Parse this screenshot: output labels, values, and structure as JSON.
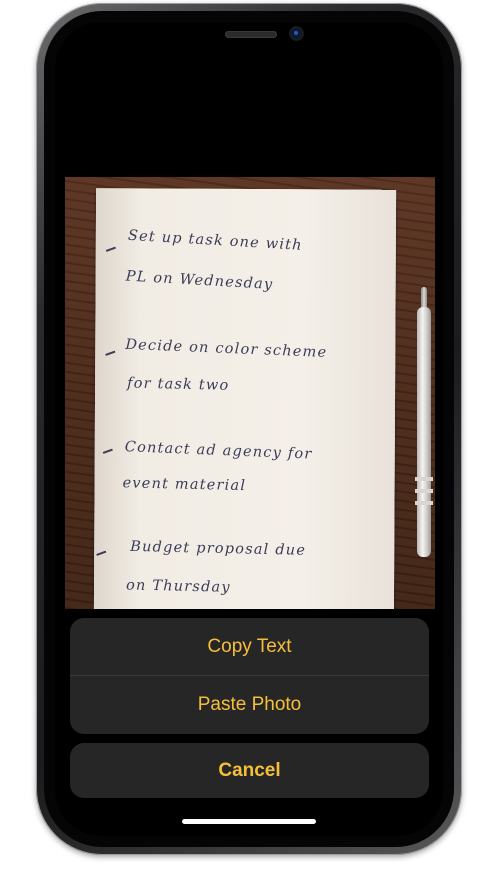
{
  "action_sheet": {
    "copy_text_label": "Copy Text",
    "paste_photo_label": "Paste Photo",
    "cancel_label": "Cancel"
  },
  "photo": {
    "notes": [
      "Set up task one with",
      "PL on Wednesday",
      "Decide on color scheme",
      "for task two",
      "Contact ad agency for",
      "event material",
      "Budget proposal due",
      "on Thursday"
    ]
  },
  "colors": {
    "accent": "#f6bf3a",
    "sheet_background": "#262626",
    "screen_background": "#000000"
  }
}
